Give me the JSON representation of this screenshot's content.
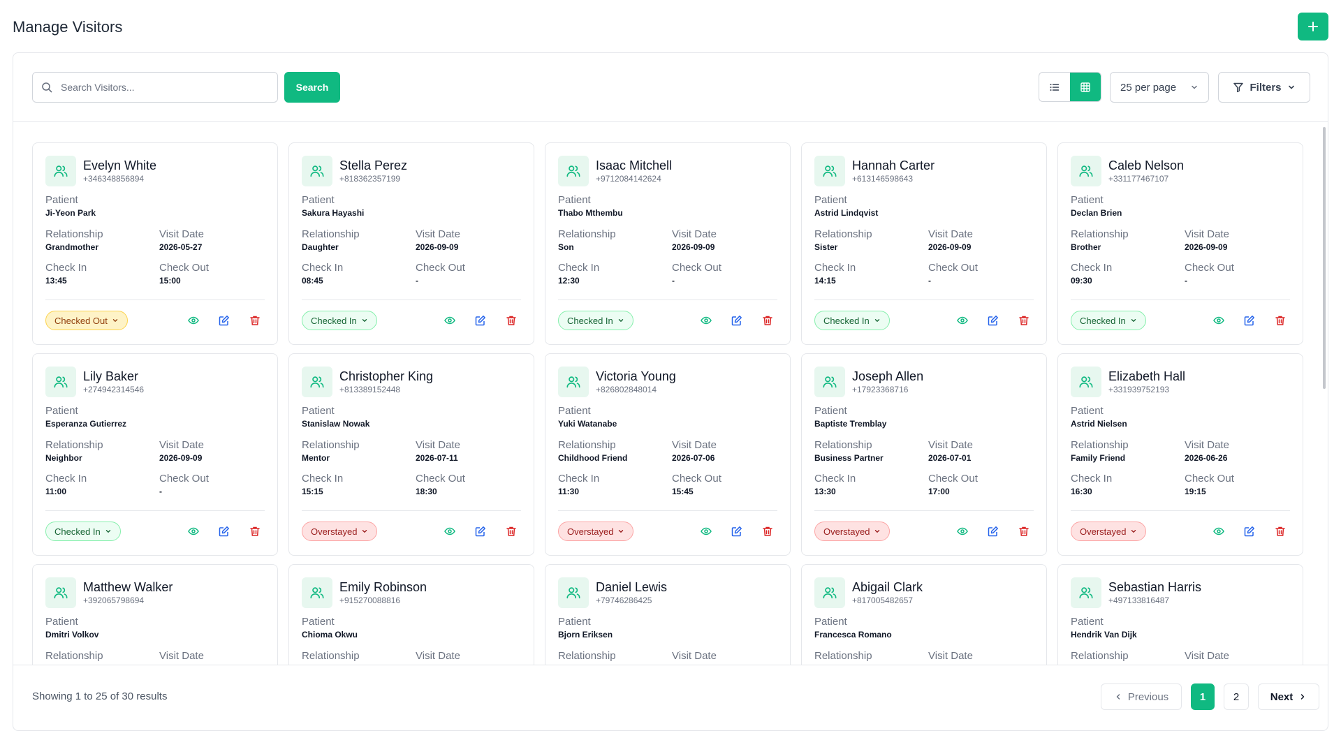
{
  "header": {
    "title": "Manage Visitors"
  },
  "search": {
    "placeholder": "Search Visitors...",
    "value": "",
    "button_label": "Search"
  },
  "toolbar": {
    "per_page": "25 per page",
    "filters_label": "Filters"
  },
  "labels": {
    "patient": "Patient",
    "relationship": "Relationship",
    "visit_date": "Visit Date",
    "check_in": "Check In",
    "check_out": "Check Out"
  },
  "colors": {
    "accent": "#10b981"
  },
  "visitors": [
    {
      "name": "Evelyn White",
      "phone": "+346348856894",
      "patient": "Ji-Yeon Park",
      "relationship": "Grandmother",
      "visit_date": "2026-05-27",
      "check_in": "13:45",
      "check_out": "15:00",
      "status": "Checked Out",
      "status_kind": "out"
    },
    {
      "name": "Stella Perez",
      "phone": "+818362357199",
      "patient": "Sakura Hayashi",
      "relationship": "Daughter",
      "visit_date": "2026-09-09",
      "check_in": "08:45",
      "check_out": "-",
      "status": "Checked In",
      "status_kind": "in"
    },
    {
      "name": "Isaac Mitchell",
      "phone": "+9712084142624",
      "patient": "Thabo Mthembu",
      "relationship": "Son",
      "visit_date": "2026-09-09",
      "check_in": "12:30",
      "check_out": "-",
      "status": "Checked In",
      "status_kind": "in"
    },
    {
      "name": "Hannah Carter",
      "phone": "+613146598643",
      "patient": "Astrid Lindqvist",
      "relationship": "Sister",
      "visit_date": "2026-09-09",
      "check_in": "14:15",
      "check_out": "-",
      "status": "Checked In",
      "status_kind": "in"
    },
    {
      "name": "Caleb Nelson",
      "phone": "+331177467107",
      "patient": "Declan Brien",
      "relationship": "Brother",
      "visit_date": "2026-09-09",
      "check_in": "09:30",
      "check_out": "-",
      "status": "Checked In",
      "status_kind": "in"
    },
    {
      "name": "Lily Baker",
      "phone": "+274942314546",
      "patient": "Esperanza Gutierrez",
      "relationship": "Neighbor",
      "visit_date": "2026-09-09",
      "check_in": "11:00",
      "check_out": "-",
      "status": "Checked In",
      "status_kind": "in"
    },
    {
      "name": "Christopher King",
      "phone": "+813389152448",
      "patient": "Stanislaw Nowak",
      "relationship": "Mentor",
      "visit_date": "2026-07-11",
      "check_in": "15:15",
      "check_out": "18:30",
      "status": "Overstayed",
      "status_kind": "over"
    },
    {
      "name": "Victoria Young",
      "phone": "+826802848014",
      "patient": "Yuki Watanabe",
      "relationship": "Childhood Friend",
      "visit_date": "2026-07-06",
      "check_in": "11:30",
      "check_out": "15:45",
      "status": "Overstayed",
      "status_kind": "over"
    },
    {
      "name": "Joseph Allen",
      "phone": "+17923368716",
      "patient": "Baptiste Tremblay",
      "relationship": "Business Partner",
      "visit_date": "2026-07-01",
      "check_in": "13:30",
      "check_out": "17:00",
      "status": "Overstayed",
      "status_kind": "over"
    },
    {
      "name": "Elizabeth Hall",
      "phone": "+331939752193",
      "patient": "Astrid Nielsen",
      "relationship": "Family Friend",
      "visit_date": "2026-06-26",
      "check_in": "16:30",
      "check_out": "19:15",
      "status": "Overstayed",
      "status_kind": "over"
    },
    {
      "name": "Matthew Walker",
      "phone": "+392065798694",
      "patient": "Dmitri Volkov",
      "relationship": "",
      "visit_date": "",
      "check_in": "",
      "check_out": "",
      "status": "",
      "status_kind": ""
    },
    {
      "name": "Emily Robinson",
      "phone": "+915270088816",
      "patient": "Chioma Okwu",
      "relationship": "",
      "visit_date": "",
      "check_in": "",
      "check_out": "",
      "status": "",
      "status_kind": ""
    },
    {
      "name": "Daniel Lewis",
      "phone": "+79746286425",
      "patient": "Bjorn Eriksen",
      "relationship": "",
      "visit_date": "",
      "check_in": "",
      "check_out": "",
      "status": "",
      "status_kind": ""
    },
    {
      "name": "Abigail Clark",
      "phone": "+817005482657",
      "patient": "Francesca Romano",
      "relationship": "",
      "visit_date": "",
      "check_in": "",
      "check_out": "",
      "status": "",
      "status_kind": ""
    },
    {
      "name": "Sebastian Harris",
      "phone": "+497133816487",
      "patient": "Hendrik Van Dijk",
      "relationship": "",
      "visit_date": "",
      "check_in": "",
      "check_out": "",
      "status": "",
      "status_kind": ""
    }
  ],
  "footer": {
    "showing": "Showing 1 to 25 of 30 results",
    "previous": "Previous",
    "next": "Next",
    "pages": [
      "1",
      "2"
    ],
    "current_page": "1"
  }
}
